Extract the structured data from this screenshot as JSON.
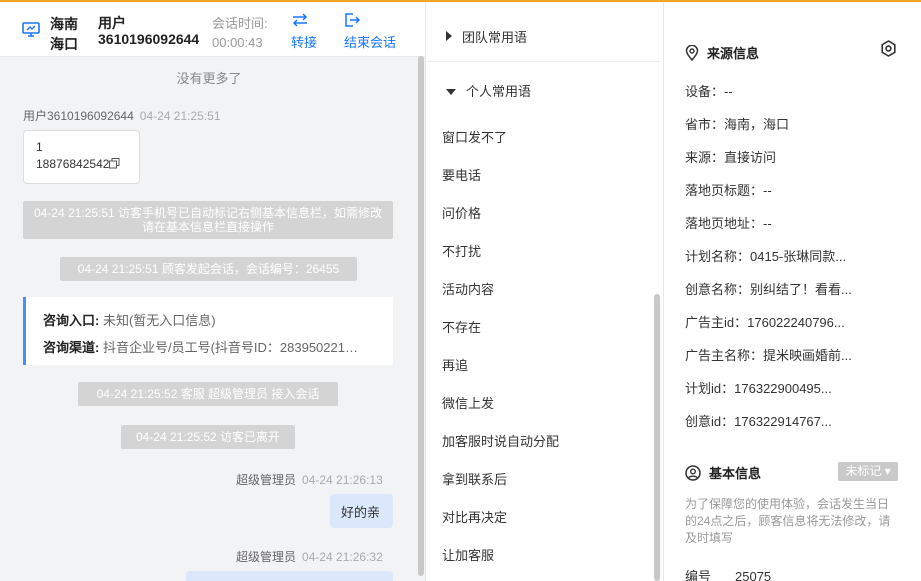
{
  "header": {
    "location": "海南海口",
    "user": "用户3610196092644",
    "timer_label": "会话时间:",
    "timer_value": "00:00:43",
    "transfer_label": "转接",
    "end_label": "结束会话"
  },
  "chat": {
    "no_more": "没有更多了",
    "visitor_name": "用户3610196092644",
    "visitor_time": "04-24 21:25:51",
    "visitor_msg_line1": "1",
    "visitor_msg_line2": "18876842542",
    "sys1": "04-24 21:25:51 访客手机号已自动标记右侧基本信息栏，如需修改请在基本信息栏直接操作",
    "sys2": "04-24 21:25:51 顾客发起会话，会话编号：26455",
    "consult_entry_label": "咨询入口:",
    "consult_entry_value": "未知(暂无入口信息)",
    "consult_channel_label": "咨询渠道:",
    "consult_channel_value": "抖音企业号/员工号(抖音号ID：283950221…",
    "sys3": "04-24 21:25:52 客服 超级管理员 接入会话",
    "sys4": "04-24 21:25:52 访客已离开",
    "agent_name": "超级管理员",
    "agent_time1": "04-24 21:26:13",
    "agent_reply1": "好的亲",
    "agent_time2": "04-24 21:26:32"
  },
  "phrases": {
    "team_label": "团队常用语",
    "personal_label": "个人常用语",
    "items": [
      "窗口发不了",
      "要电话",
      "问价格",
      "不打扰",
      "活动内容",
      "不存在",
      "再追",
      "微信上发",
      "加客服时说自动分配",
      "拿到联系后",
      "对比再决定",
      "让加客服"
    ]
  },
  "source": {
    "title": "来源信息",
    "rows": [
      {
        "label": "设备：",
        "value": "--"
      },
      {
        "label": "省市：",
        "value": "海南，海口"
      },
      {
        "label": "来源：",
        "value": "直接访问"
      },
      {
        "label": "落地页标题：",
        "value": "--"
      },
      {
        "label": "落地页地址：",
        "value": "--"
      },
      {
        "label": "计划名称：",
        "value": "0415-张琳同款..."
      },
      {
        "label": "创意名称：",
        "value": "别纠结了！看看..."
      },
      {
        "label": "广告主id：",
        "value": "176022240796..."
      },
      {
        "label": "广告主名称：",
        "value": "提米映画婚前..."
      },
      {
        "label": "计划id：",
        "value": "176322900495..."
      },
      {
        "label": "创意id：",
        "value": "176322914767..."
      }
    ]
  },
  "basic": {
    "title": "基本信息",
    "badge": "未标记",
    "notice": "为了保障您的使用体验，会话发生当日的24点之后，顾客信息将无法修改，请及时填写",
    "num_label": "编号",
    "num_value": "25075"
  },
  "colors": {
    "accent": "#1677ff",
    "top_bar": "#f5a623",
    "consult_border": "#4a8ff7"
  }
}
